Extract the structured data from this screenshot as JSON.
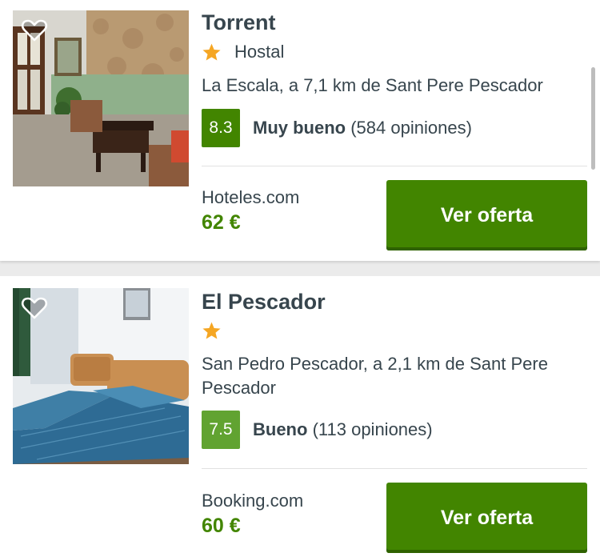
{
  "colors": {
    "brand_green": "#428500",
    "score_good": "#61a331",
    "text": "#37454d",
    "star": "#f5a623"
  },
  "hotels": [
    {
      "name": "Torrent",
      "stars": 1,
      "type": "Hostal",
      "location": "La Escala, a 7,1 km de Sant Pere Pescador",
      "score": "8.3",
      "rating_label": "Muy bueno",
      "reviews": "(584 opiniones)",
      "provider": "Hoteles.com",
      "price": "62 €",
      "cta": "Ver oferta",
      "favorite_icon": "heart-outline-icon"
    },
    {
      "name": "El Pescador",
      "stars": 1,
      "type": "",
      "location": "San Pedro Pescador, a 2,1 km de Sant Pere Pescador",
      "score": "7.5",
      "rating_label": "Bueno",
      "reviews": "(113 opiniones)",
      "provider": "Booking.com",
      "price": "60 €",
      "cta": "Ver oferta",
      "favorite_icon": "heart-outline-icon"
    }
  ]
}
